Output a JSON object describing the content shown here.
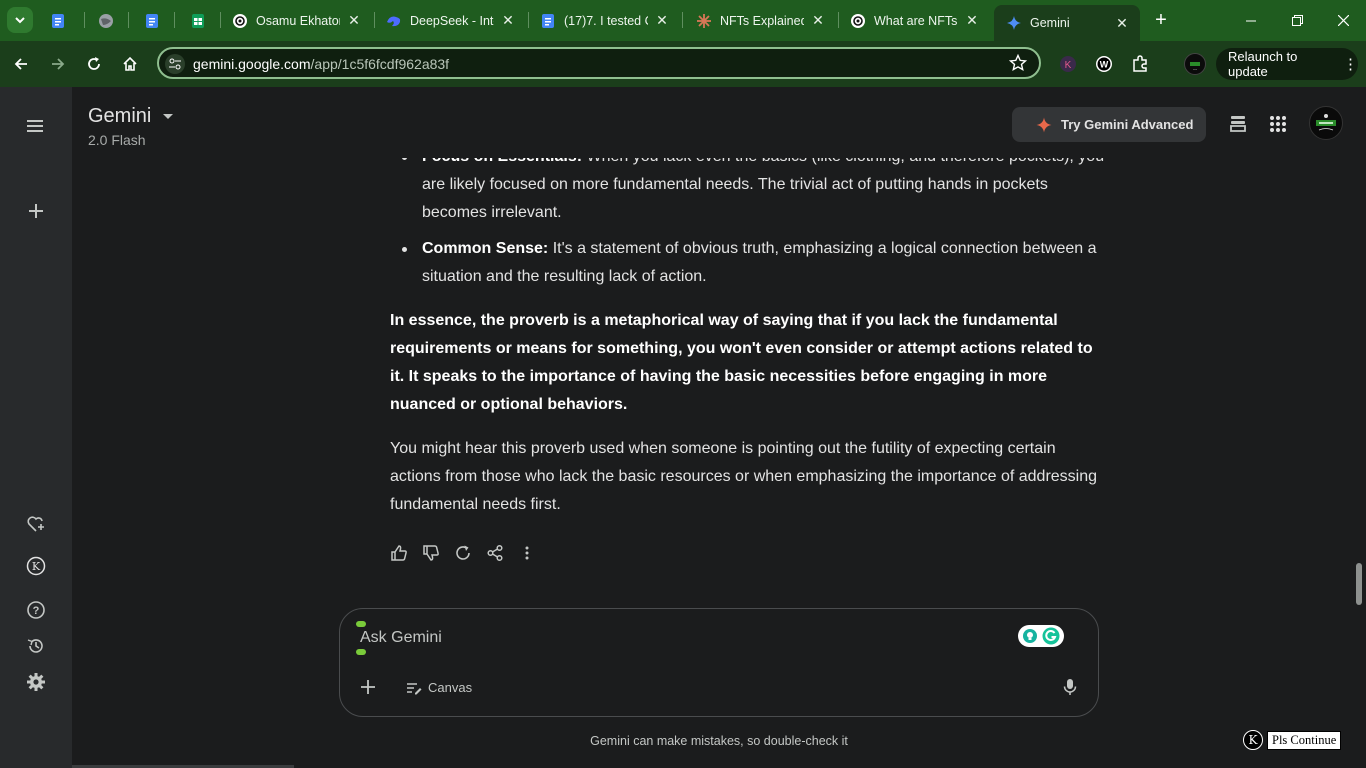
{
  "browser": {
    "tabs": [
      {
        "title": "",
        "icon": "docs-icon",
        "active": false
      },
      {
        "title": "",
        "icon": "globe-icon",
        "active": false
      },
      {
        "title": "",
        "icon": "docs-icon",
        "active": false
      },
      {
        "title": "",
        "icon": "sheets-icon",
        "active": false
      },
      {
        "title": "Osamu Ekhator",
        "icon": "openai-icon",
        "active": false
      },
      {
        "title": "DeepSeek - Into",
        "icon": "deepseek-icon",
        "active": false
      },
      {
        "title": "(17)7. I tested C",
        "icon": "docs-icon",
        "active": false
      },
      {
        "title": "NFTs Explained",
        "icon": "claude-icon",
        "active": false
      },
      {
        "title": "What are NFTs",
        "icon": "openai-icon",
        "active": false
      },
      {
        "title": "Gemini",
        "icon": "gemini-spark-icon",
        "active": true
      }
    ],
    "url_host": "gemini.google.com",
    "url_path": "/app/1c5f6fcdf962a83f",
    "relaunch_label": "Relaunch to update",
    "colors": {
      "frame": "#1f5c1f",
      "toolbar": "#1b3e1b"
    }
  },
  "app": {
    "title": "Gemini",
    "model": "2.0 Flash",
    "try_advanced_label": "Try Gemini Advanced"
  },
  "response": {
    "bullets": [
      {
        "bold": "Focus on Essentials:",
        "text": " When you lack even the basics (like clothing, and therefore pockets), you are likely focused on more fundamental needs. The trivial act of putting hands in pockets becomes irrelevant."
      },
      {
        "bold": "Common Sense:",
        "text": " It's a statement of obvious truth, emphasizing a logical connection between a situation and the resulting lack of action."
      }
    ],
    "summary": "In essence, the proverb is a metaphorical way of saying that if you lack the fundamental requirements or means for something, you won't even consider or attempt actions related to it. It speaks to the importance of having the basic necessities before engaging in more nuanced or optional behaviors.",
    "closing": "You might hear this proverb used when someone is pointing out the futility of expecting certain actions from those who lack the basic resources or when emphasizing the importance of addressing fundamental needs first."
  },
  "input": {
    "placeholder": "Ask Gemini",
    "canvas_label": "Canvas"
  },
  "footer": {
    "disclaimer": "Gemini can make mistakes, so double-check it",
    "extension_button": "Pls Continue",
    "extension_badge": "K"
  }
}
